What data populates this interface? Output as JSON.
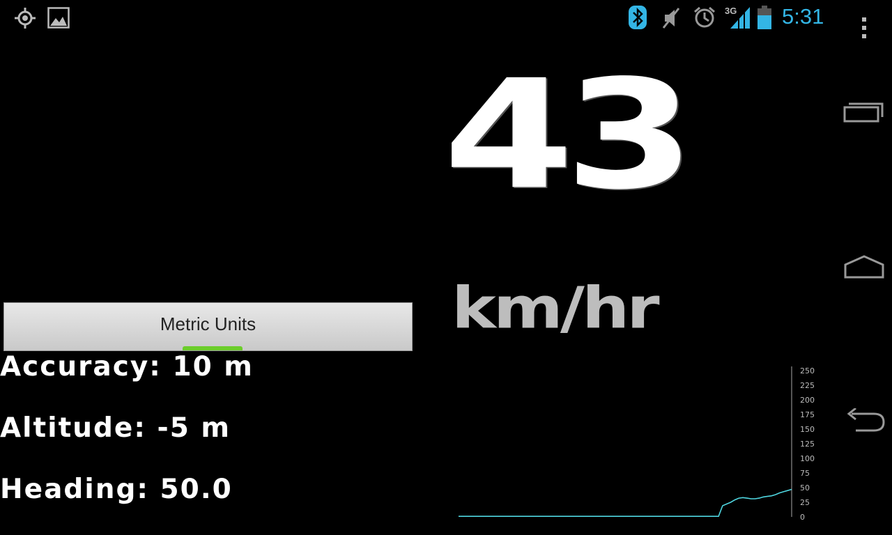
{
  "status_bar": {
    "left_icons": [
      "gps-icon",
      "gallery-icon"
    ],
    "right_icons": [
      "bluetooth-icon",
      "muted-icon",
      "alarm-icon",
      "signal-3g-icon",
      "battery-icon"
    ],
    "network_type": "3G",
    "time": "5:31",
    "accent_color": "#33b5e5"
  },
  "nav_bar": {
    "buttons": [
      "overflow-menu-icon",
      "recent-apps-icon",
      "home-icon",
      "back-icon"
    ]
  },
  "speed": {
    "value": "43",
    "unit": "km/hr"
  },
  "units_button": {
    "label": "Metric Units",
    "indicator_color": "#6ccd2b"
  },
  "info": {
    "accuracy": "Accuracy: 10 m",
    "altitude": "Altitude: -5 m",
    "heading": "Heading: 50.0"
  },
  "chart_data": {
    "type": "line",
    "title": "",
    "xlabel": "",
    "ylabel": "",
    "ylim": [
      0,
      250
    ],
    "yticks": [
      "250",
      "225",
      "200",
      "175",
      "150",
      "125",
      "100",
      "75",
      "50",
      "25",
      "0"
    ],
    "y_axis_side": "right",
    "grid": false,
    "line_color": "#4fd6e0",
    "series": [
      {
        "values": [
          1,
          1,
          1,
          1,
          1,
          1,
          1,
          1,
          1,
          1,
          1,
          1,
          1,
          1,
          1,
          1,
          1,
          1,
          1,
          1,
          1,
          1,
          1,
          1,
          1,
          1,
          1,
          1,
          1,
          1,
          1,
          1,
          1,
          1,
          1,
          1,
          1,
          1,
          1,
          1,
          1,
          1,
          1,
          1,
          1,
          1,
          1,
          1,
          1,
          1,
          1,
          1,
          1,
          1,
          1,
          1,
          1,
          1,
          1,
          1,
          1,
          1,
          1,
          1,
          1,
          19,
          22,
          25,
          29,
          32,
          33,
          32,
          31,
          31,
          32,
          34,
          35,
          36,
          38,
          41,
          43,
          45,
          47
        ]
      }
    ]
  }
}
